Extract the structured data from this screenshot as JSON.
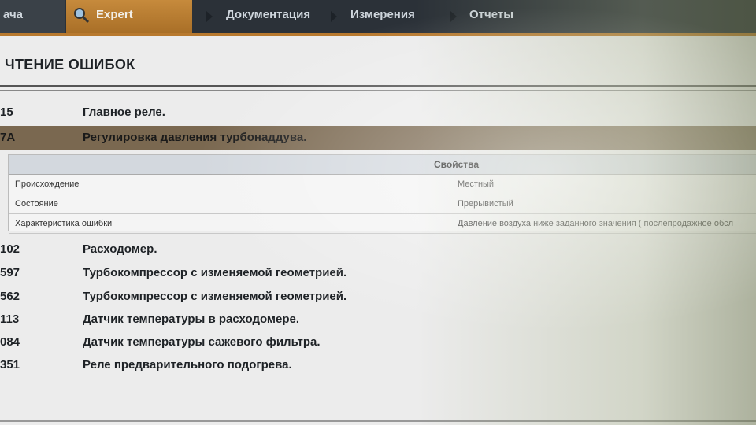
{
  "nav": {
    "tab_left": "ача",
    "tab_expert": "Expert",
    "tab_documentation": "Документация",
    "tab_measurements": "Измерения",
    "tab_reports": "Отчеты"
  },
  "page": {
    "title": "ЧТЕНИЕ ОШИБОК"
  },
  "faults_top": [
    {
      "code": "15",
      "description": "Главное реле."
    },
    {
      "code": "7A",
      "description": "Регулировка давления турбонаддува."
    }
  ],
  "properties": {
    "header": "Свойства",
    "rows": [
      {
        "key": "Происхождение",
        "value": "Местный"
      },
      {
        "key": "Состояние",
        "value": "Прерывистый"
      },
      {
        "key": "Характеристика ошибки",
        "value": "Давление воздуха ниже заданного значения ( послепродажное обсл"
      }
    ]
  },
  "faults_bottom": [
    {
      "code": "102",
      "description": "Расходомер."
    },
    {
      "code": "597",
      "description": "Турбокомпрессор с изменяемой геометрией."
    },
    {
      "code": "562",
      "description": "Турбокомпрессор с изменяемой геометрией."
    },
    {
      "code": "113",
      "description": "Датчик температуры в расходомере."
    },
    {
      "code": "084",
      "description": "Датчик температуры сажевого фильтра."
    },
    {
      "code": "351",
      "description": "Реле предварительного подогрева."
    }
  ],
  "colors": {
    "accent": "#b8792e",
    "nav_bg": "#2b3138",
    "selected_row": "#7a6850"
  }
}
